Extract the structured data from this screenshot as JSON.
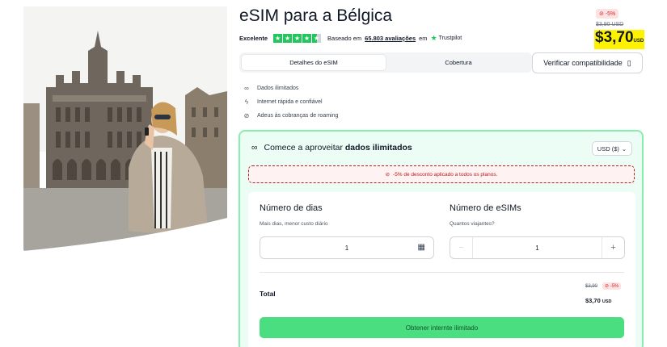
{
  "product": {
    "title": "eSIM para a Bélgica",
    "rating_label": "Excelente",
    "based_on_prefix": "Baseado em",
    "reviews_link": "65.803 avaliações",
    "on_word": "em",
    "trustpilot": "Trustpilot"
  },
  "price": {
    "discount_badge": "-5%",
    "old": "$3,90 USD",
    "new": "$3,70",
    "currency_code": "USD"
  },
  "tabs": [
    {
      "label": "Detalhes do eSIM",
      "active": true
    },
    {
      "label": "Cobertura",
      "active": false
    }
  ],
  "verify_button": "Verificar compatibilidade",
  "features": [
    {
      "icon": "infinity-icon",
      "text": "Dados ilimitados"
    },
    {
      "icon": "lightning-icon",
      "text": "Internet rápida e confiável"
    },
    {
      "icon": "no-roaming-icon",
      "text": "Adeus às cobranças de roaming"
    }
  ],
  "card": {
    "heading_prefix": "Comece a aproveitar",
    "heading_bold": "dados ilimitados",
    "currency_select": "USD ($)",
    "notice": "-5% de desconto aplicado a todos os planos.",
    "days": {
      "title": "Número de dias",
      "subtitle": "Mais dias, menor custo diário",
      "value": "1"
    },
    "esims": {
      "title": "Número de eSIMs",
      "subtitle": "Quantos viajantes?",
      "value": "1"
    },
    "total_label": "Total",
    "total_old": "$3,90",
    "total_badge": "-5%",
    "total_new": "$3,70",
    "total_currency": "USD",
    "cta": "Obtener internte ilimitado"
  },
  "colors": {
    "accent_green": "#4ade80",
    "price_highlight": "#fff200",
    "discount_red": "#dc2626"
  }
}
